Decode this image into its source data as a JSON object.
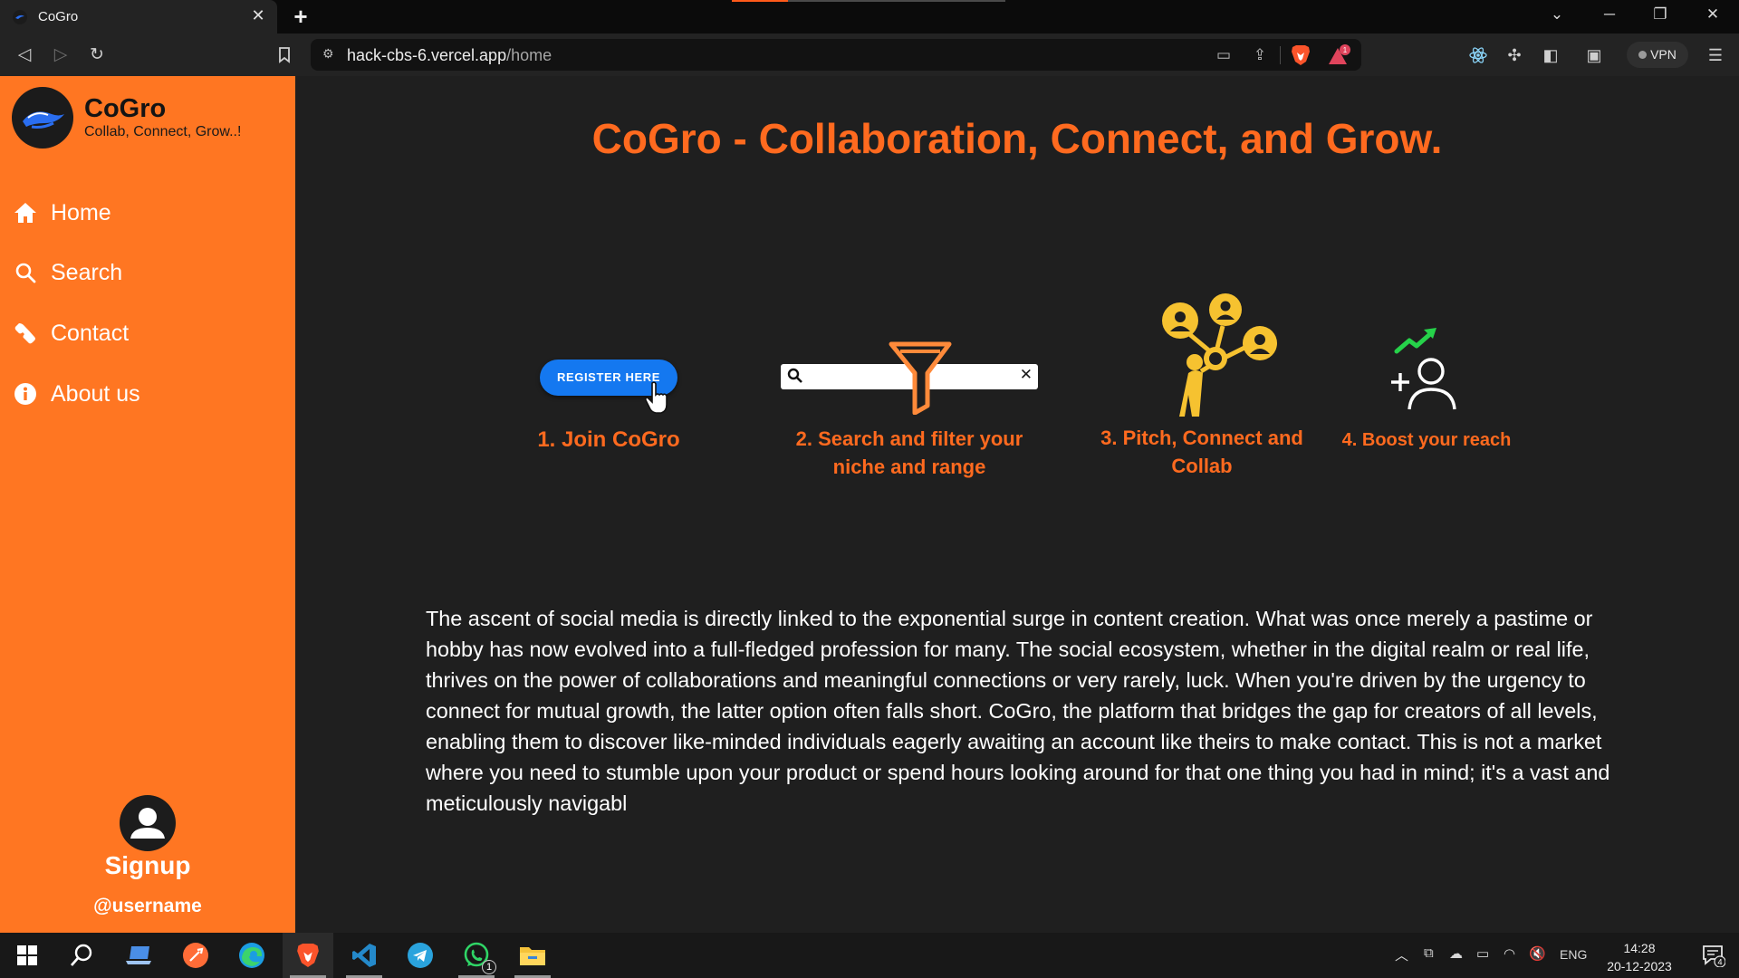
{
  "browser": {
    "tab_title": "CoGro",
    "url_host": "hack-cbs-6.vercel.app",
    "url_path": "/home",
    "vpn_label": "VPN",
    "rewards_count": "1"
  },
  "sidebar": {
    "brand_name": "CoGro",
    "brand_tagline": "Collab, Connect, Grow..!",
    "nav": [
      {
        "label": "Home",
        "icon": "home-icon"
      },
      {
        "label": "Search",
        "icon": "search-icon"
      },
      {
        "label": "Contact",
        "icon": "phone-icon"
      },
      {
        "label": "About us",
        "icon": "info-icon"
      }
    ],
    "signup_label": "Signup",
    "username": "@username"
  },
  "main": {
    "headline": "CoGro - Collaboration, Connect, and Grow.",
    "register_button": "REGISTER HERE",
    "steps": [
      "1. Join CoGro",
      "2. Search and filter your niche and range",
      "3. Pitch, Connect and Collab",
      "4. Boost your reach"
    ],
    "description": "The ascent of social media is directly linked to the exponential surge in content creation. What was once merely a pastime or hobby has now evolved into a full-fledged profession for many. The social ecosystem, whether in the digital realm or real life, thrives on the power of collaborations and meaningful connections or very rarely, luck. When you're driven by the urgency to connect for mutual growth, the latter option often falls short. CoGro, the platform that bridges the gap for creators of all levels, enabling them to discover like-minded individuals eagerly awaiting an account like theirs to make contact. This is not a market where you need to stumble upon your product or spend hours looking around for that one thing you had in mind; it's a vast and meticulously navigabl"
  },
  "taskbar": {
    "language": "ENG",
    "time": "14:28",
    "date": "20-12-2023",
    "notification_count": "4",
    "whatsapp_badge": "1"
  },
  "colors": {
    "accent": "#ff6a1f",
    "sidebar": "#ff7622",
    "background": "#1f1f1f",
    "register_blue": "#1478f0",
    "icon_gold": "#f6c230"
  }
}
